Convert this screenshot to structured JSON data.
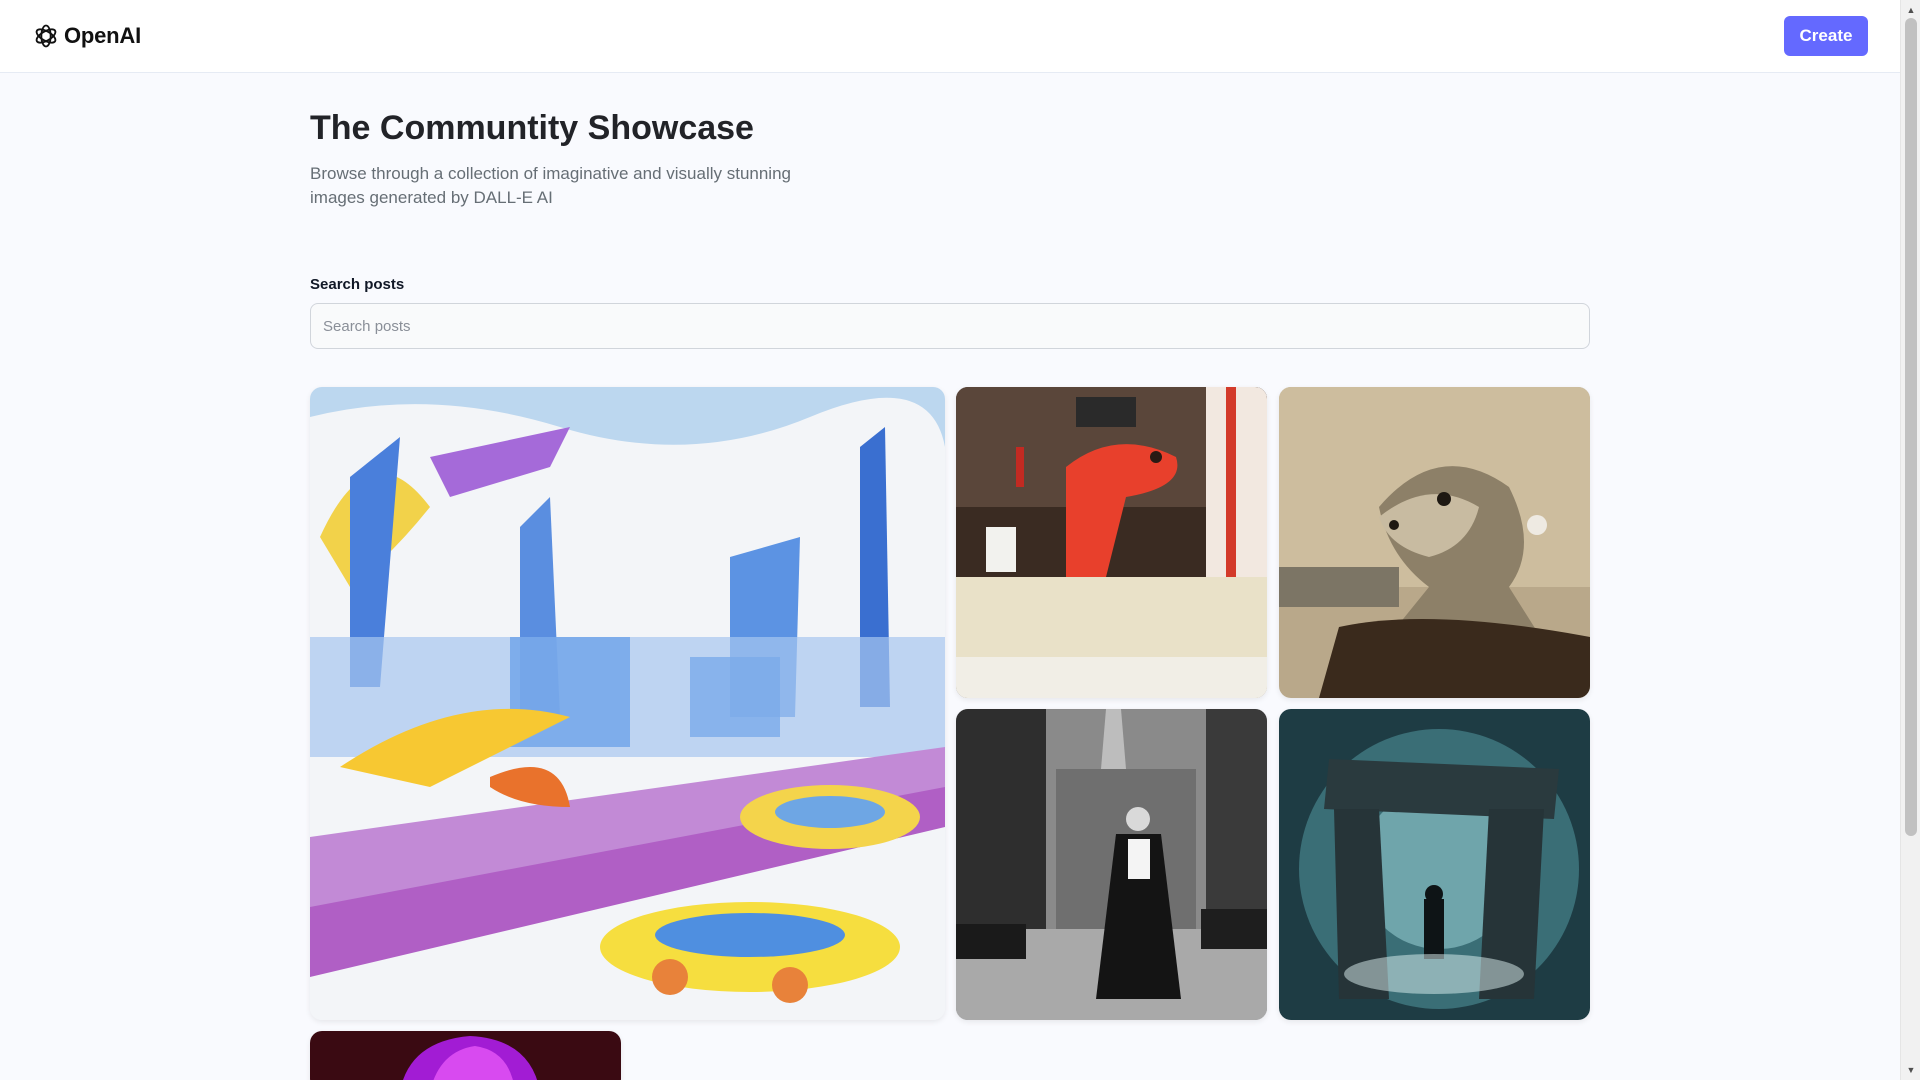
{
  "header": {
    "logo_text": "OpenAI",
    "create_label": "Create"
  },
  "main": {
    "title": "The Communtity Showcase",
    "subtitle": "Browse through a collection of imaginative and visually stunning images generated by DALL-E AI",
    "search_label": "Search posts",
    "search_placeholder": "Search posts"
  },
  "colors": {
    "accent": "#6469ff",
    "background": "#f9fafe",
    "title": "#222328",
    "subtitle": "#666e75"
  },
  "gallery": {
    "images": [
      {
        "subject": "crayon-drawing-futuristic-city"
      },
      {
        "subject": "dinosaur-hot-dog-stand"
      },
      {
        "subject": "seal-pearl-earring-portrait"
      },
      {
        "subject": "vampire-black-and-white-street"
      },
      {
        "subject": "stonehenge-cosmic-portal"
      },
      {
        "subject": "neon-statue-bust"
      }
    ]
  }
}
